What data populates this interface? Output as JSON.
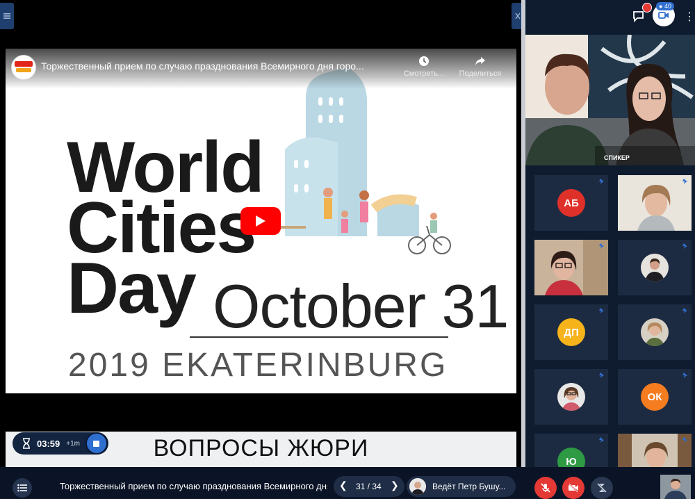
{
  "video": {
    "title": "Торжественный прием по случаю празднования Всемирного дня горо...",
    "watch_later_label": "Смотреть...",
    "share_label": "Поделиться",
    "poster": {
      "title_line1": "World",
      "title_line2": "Cities",
      "title_line3": "Day",
      "date": "October 31",
      "city": "2019 EKATERINBURG"
    }
  },
  "banner": {
    "text": "ВОПРОСЫ ЖЮРИ"
  },
  "timer": {
    "value": "03:59",
    "extend_label": "+1m"
  },
  "top_right": {
    "participants_count": "40"
  },
  "speaker": {
    "label": "СПИКЕР"
  },
  "participants": [
    {
      "initials": "АБ",
      "color": "#e0302a"
    },
    {
      "initials": "",
      "color": ""
    },
    {
      "initials": "",
      "color": ""
    },
    {
      "initials": "",
      "color": ""
    },
    {
      "initials": "ДП",
      "color": "#f6b31a"
    },
    {
      "initials": "",
      "color": ""
    },
    {
      "initials": "",
      "color": ""
    },
    {
      "initials": "ОК",
      "color": "#f57c1f"
    },
    {
      "initials": "Ю",
      "color": "#2e9a44"
    },
    {
      "initials": "",
      "color": ""
    }
  ],
  "bottombar": {
    "title": "Торжественный прием по случаю празднования Всемирного дня...",
    "slide_counter": "31 / 34",
    "host_text": "Ведёт Петр Бушу..."
  },
  "colors": {
    "panel_bg": "#0f1c30",
    "accent": "#2f6fd0",
    "danger": "#e53935"
  }
}
